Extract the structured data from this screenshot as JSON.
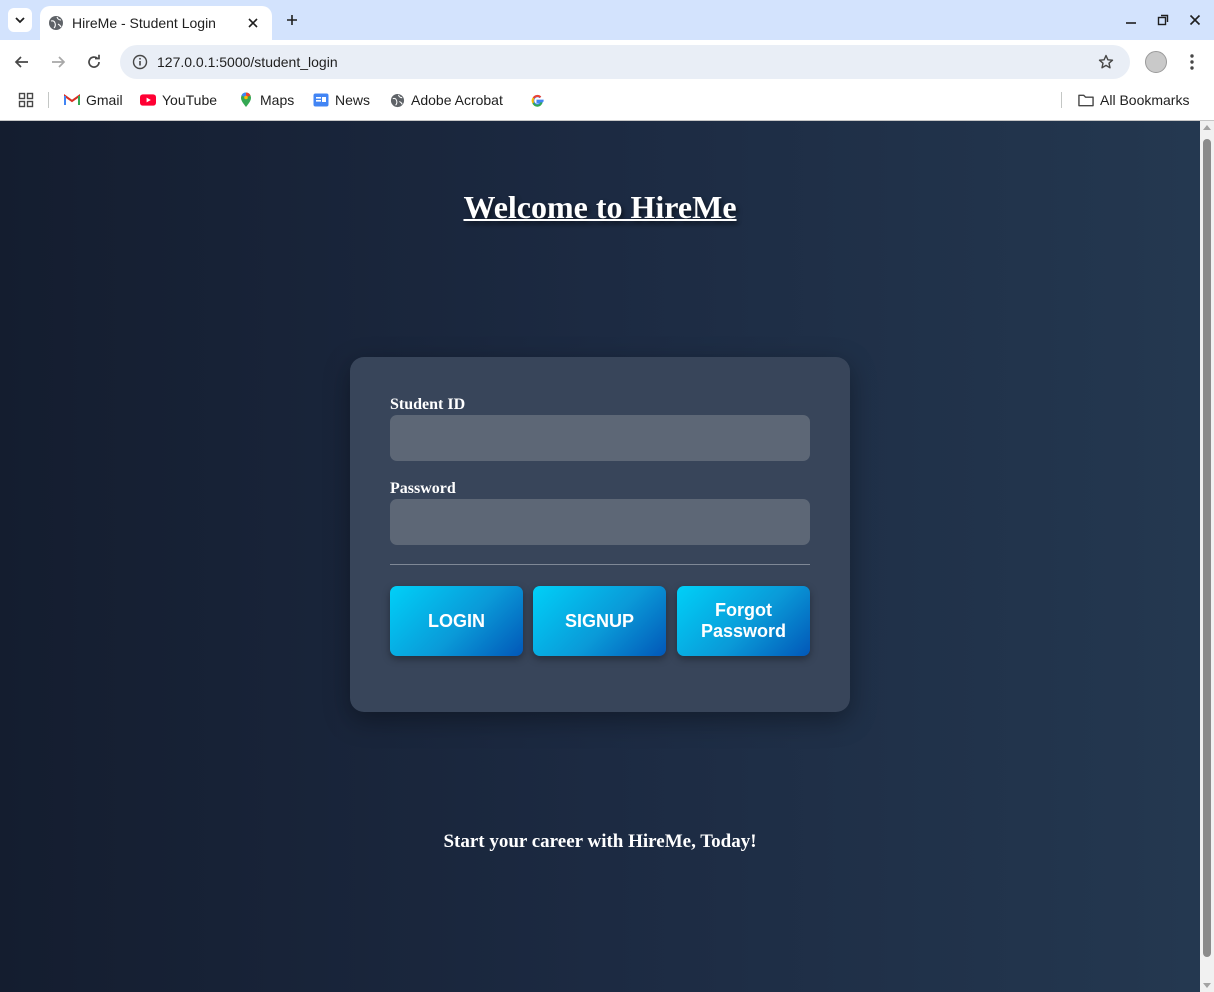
{
  "browser": {
    "tab_title": "HireMe - Student Login",
    "url": "127.0.0.1:5000/student_login",
    "bookmarks": [
      {
        "label": "Gmail",
        "icon": "gmail-icon"
      },
      {
        "label": "YouTube",
        "icon": "youtube-icon"
      },
      {
        "label": "Maps",
        "icon": "maps-icon"
      },
      {
        "label": "News",
        "icon": "news-icon"
      },
      {
        "label": "Adobe Acrobat",
        "icon": "globe-icon"
      },
      {
        "label": "",
        "icon": "google-icon"
      }
    ],
    "all_bookmarks_label": "All Bookmarks"
  },
  "page": {
    "heading": "Welcome to HireMe",
    "form": {
      "student_id_label": "Student ID",
      "student_id_value": "",
      "password_label": "Password",
      "password_value": "",
      "login_label": "LOGIN",
      "signup_label": "SIGNUP",
      "forgot_label": "Forgot Password"
    },
    "tagline": "Start your career with HireMe, Today!"
  },
  "colors": {
    "tabstrip": "#d3e3fd",
    "background_start": "#141d2f",
    "background_end": "#243850",
    "card": "#38455a",
    "input": "#5d6776",
    "button_start": "#00d0f8",
    "button_end": "#0257b8"
  }
}
